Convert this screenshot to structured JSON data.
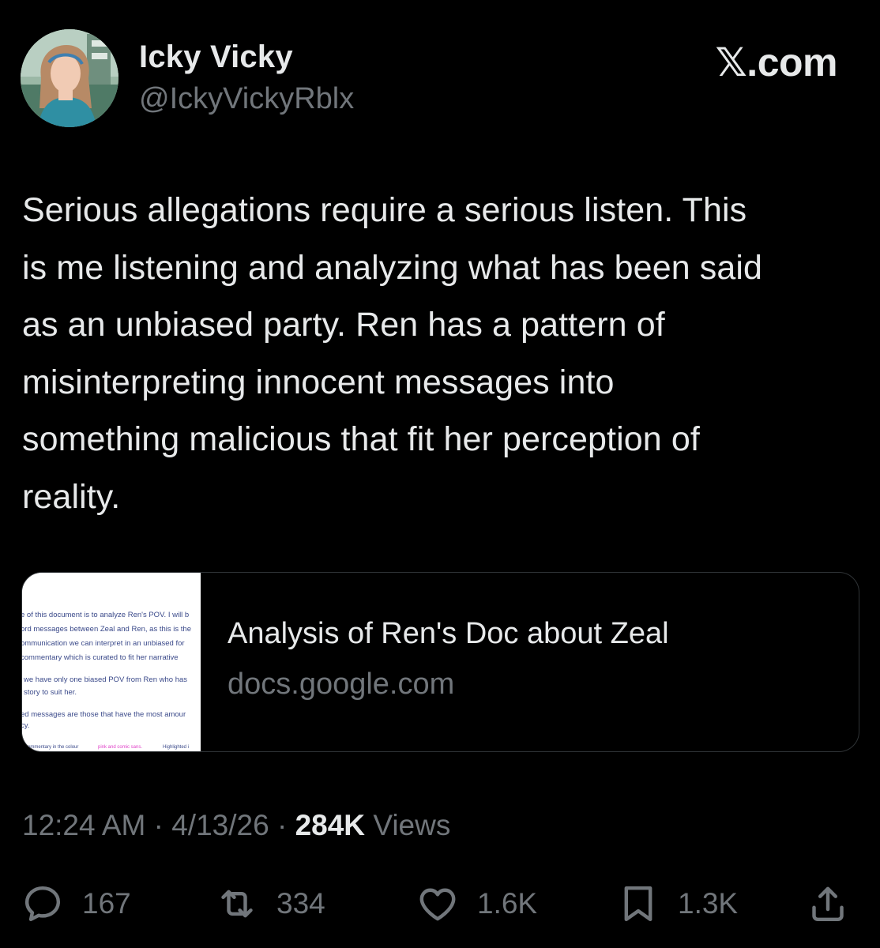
{
  "author": {
    "display_name": "Icky Vicky",
    "handle": "@IckyVickyRblx"
  },
  "brand": "𝕏.com",
  "tweet": {
    "text_lines": [
      "Serious allegations require a serious listen. This",
      "is me listening and analyzing what has been said",
      "as an unbiased party. Ren has a pattern of",
      "misinterpreting innocent messages into",
      "something malicious that fit her perception of",
      "reality."
    ]
  },
  "link_card": {
    "title": "Analysis of Ren's Doc about Zeal",
    "domain": "docs.google.com",
    "thumbnail_lines": [
      "e of this document is to analyze Ren's POV. I will b",
      "ord messages between Zeal and Ren, as this is the",
      "ommunication we can interpret in an unbiased for",
      "commentary which is curated to fit her narrative",
      "we have only one biased POV from Ren who has",
      "story to suit her.",
      "ed messages are those that have the most amour",
      "cy.",
      "commentary in the colour",
      "pink and comic sans.",
      "Highlighted i"
    ]
  },
  "meta": {
    "time": "12:24 AM",
    "separator": "·",
    "date": "4/13/26",
    "views_count": "284K",
    "views_label": "Views"
  },
  "actions": {
    "reply": {
      "icon": "reply-icon",
      "count": "167"
    },
    "repost": {
      "icon": "repost-icon",
      "count": "334"
    },
    "like": {
      "icon": "heart-icon",
      "count": "1.6K"
    },
    "bookmark": {
      "icon": "bookmark-icon",
      "count": "1.3K"
    },
    "share": {
      "icon": "share-icon"
    }
  },
  "colors": {
    "background": "#000000",
    "text_primary": "#e7e9ea",
    "text_secondary": "#71767b",
    "card_border": "#2f3336",
    "thumb_text_blue": "#3b4a8a",
    "thumb_text_pink": "#e040c8"
  }
}
